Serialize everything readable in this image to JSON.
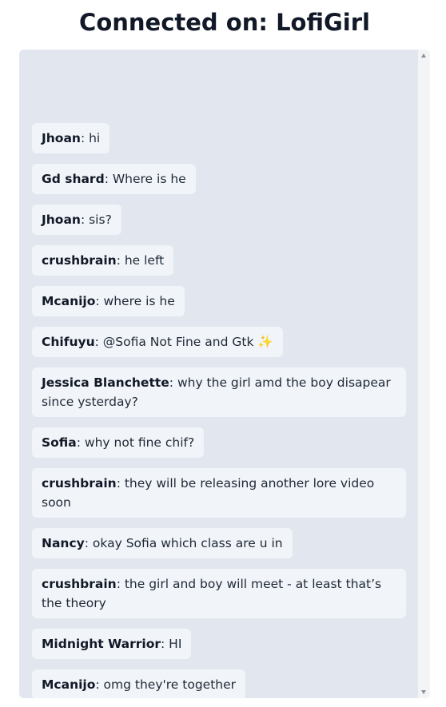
{
  "header": {
    "prefix": "Connected on: ",
    "channel": "LofiGirl"
  },
  "chat": {
    "messages": [
      {
        "user": "Jhoan",
        "text": "hi"
      },
      {
        "user": "Gd shard",
        "text": "Where is he"
      },
      {
        "user": "Jhoan",
        "text": "sis?"
      },
      {
        "user": "crushbrain",
        "text": "he left"
      },
      {
        "user": "Mcanijo",
        "text": "where is he"
      },
      {
        "user": "Chifuyu",
        "text": "@Sofia Not Fine and Gtk ✨"
      },
      {
        "user": "Jessica Blanchette",
        "text": "why the girl amd the boy disapear since ysterday?"
      },
      {
        "user": "Sofia",
        "text": "why not fine chif?"
      },
      {
        "user": "crushbrain",
        "text": "they will be releasing another lore video soon"
      },
      {
        "user": "Nancy",
        "text": "okay Sofia which class are u in"
      },
      {
        "user": "crushbrain",
        "text": "the girl and boy will meet - at least that’s the theory"
      },
      {
        "user": "Midnight Warrior",
        "text": "HI"
      },
      {
        "user": "Mcanijo",
        "text": "omg they're together"
      }
    ]
  },
  "colors": {
    "panel_bg": "#e2e7ef",
    "bubble_bg": "#f1f4f8",
    "text": "#1f2937"
  },
  "icons": {
    "scroll_up": "scroll-up-arrow-icon",
    "scroll_down": "scroll-down-arrow-icon"
  }
}
